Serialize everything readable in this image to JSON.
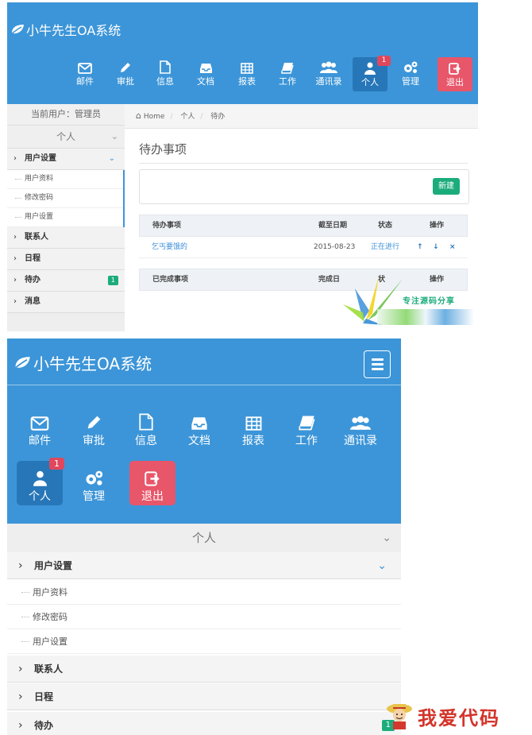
{
  "top": {
    "brand": "小牛先生OA系统",
    "nav": [
      {
        "label": "邮件",
        "icon": "envelope-icon"
      },
      {
        "label": "审批",
        "icon": "pencil-icon"
      },
      {
        "label": "信息",
        "icon": "file-icon"
      },
      {
        "label": "文档",
        "icon": "inbox-icon"
      },
      {
        "label": "报表",
        "icon": "table-icon"
      },
      {
        "label": "工作",
        "icon": "book-icon"
      },
      {
        "label": "通讯录",
        "icon": "users-icon"
      },
      {
        "label": "个人",
        "icon": "user-icon",
        "badge": "1"
      },
      {
        "label": "管理",
        "icon": "gears-icon"
      },
      {
        "label": "退出",
        "icon": "sign-out-icon"
      }
    ],
    "sidebar": {
      "current_user": "当前用户：管理员",
      "group": "个人",
      "user_settings": "用户设置",
      "sub_items": [
        "用户资料",
        "修改密码",
        "用户设置"
      ],
      "items": [
        "联系人",
        "日程",
        "待办",
        "消息"
      ],
      "todo_badge": "1"
    },
    "breadcrumb": [
      "Home",
      "个人",
      "待办"
    ],
    "page_title": "待办事项",
    "new_button": "新建",
    "todo_table": {
      "headers": [
        "待办事项",
        "截至日期",
        "状态",
        "操作"
      ],
      "rows": [
        {
          "item": "乞丐要饿的",
          "date": "2015-08-23",
          "status": "正在进行"
        }
      ]
    },
    "done_table": {
      "headers": [
        "已完成事项",
        "完成日",
        "状",
        "操作"
      ]
    },
    "watermark": "专注源码分享"
  },
  "bottom": {
    "brand": "小牛先生OA系统",
    "nav": [
      {
        "label": "邮件",
        "icon": "envelope-icon"
      },
      {
        "label": "审批",
        "icon": "pencil-icon"
      },
      {
        "label": "信息",
        "icon": "file-icon"
      },
      {
        "label": "文档",
        "icon": "inbox-icon"
      },
      {
        "label": "报表",
        "icon": "table-icon"
      },
      {
        "label": "工作",
        "icon": "book-icon"
      },
      {
        "label": "通讯录",
        "icon": "users-icon"
      },
      {
        "label": "个人",
        "icon": "user-icon",
        "badge": "1"
      },
      {
        "label": "管理",
        "icon": "gears-icon"
      },
      {
        "label": "退出",
        "icon": "sign-out-icon"
      }
    ],
    "group": "个人",
    "user_settings": "用户设置",
    "sub_items": [
      "用户资料",
      "修改密码",
      "用户设置"
    ],
    "items": [
      "联系人",
      "日程",
      "待办"
    ],
    "todo_badge": "1"
  },
  "logo_text": "我爱代码",
  "colors": {
    "header": "#3c95d8",
    "active": "#2777b8",
    "logout": "#e8566a",
    "badge": "#e0475d",
    "green": "#1cac7c",
    "link": "#3c8fd8"
  }
}
